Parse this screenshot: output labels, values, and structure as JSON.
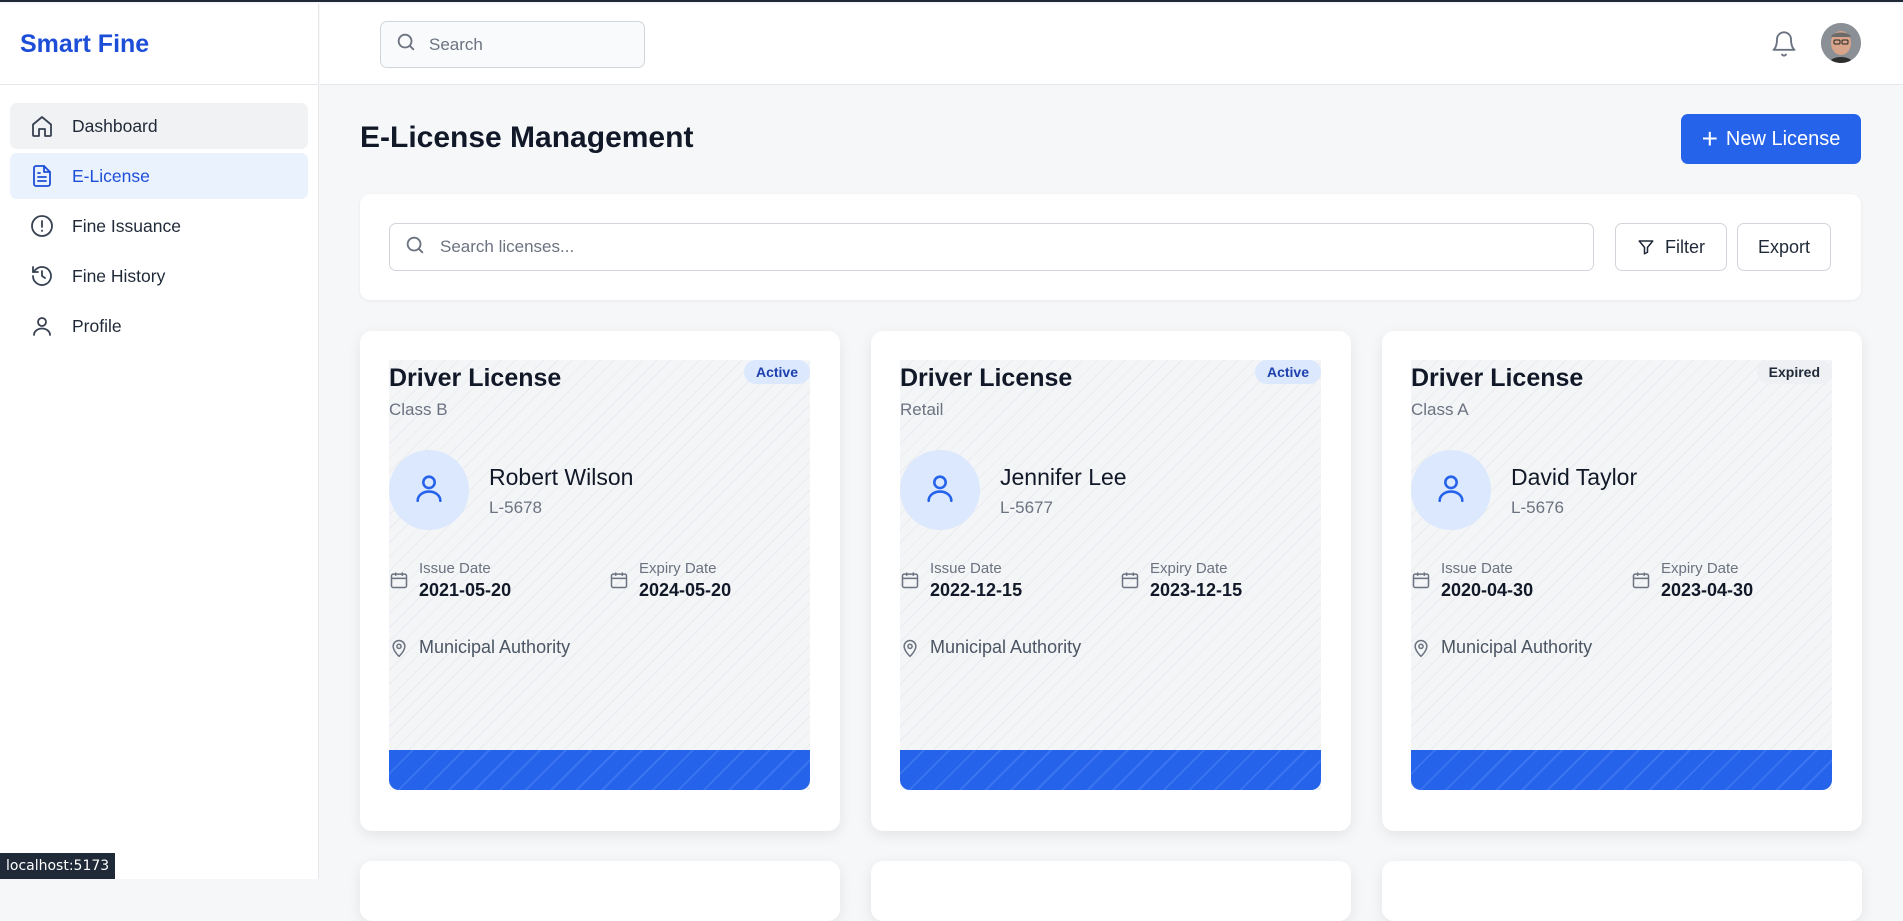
{
  "app": {
    "brand": "Smart Fine"
  },
  "sidebar": {
    "items": [
      {
        "label": "Dashboard",
        "icon": "home-icon"
      },
      {
        "label": "E-License",
        "icon": "document-icon"
      },
      {
        "label": "Fine Issuance",
        "icon": "alert-circle-icon"
      },
      {
        "label": "Fine History",
        "icon": "history-icon"
      },
      {
        "label": "Profile",
        "icon": "user-icon"
      }
    ],
    "active": "E-License"
  },
  "topbar": {
    "search_placeholder": "Search"
  },
  "page": {
    "title": "E-License Management",
    "new_button": "New License",
    "search_placeholder": "Search licenses...",
    "filter_label": "Filter",
    "export_label": "Export"
  },
  "licenses": [
    {
      "type": "Driver License",
      "class": "Class B",
      "status": "Active",
      "name": "Robert Wilson",
      "id": "L-5678",
      "issue_label": "Issue Date",
      "issue": "2021-05-20",
      "expiry_label": "Expiry Date",
      "expiry": "2024-05-20",
      "authority": "Municipal Authority"
    },
    {
      "type": "Driver License",
      "class": "Retail",
      "status": "Active",
      "name": "Jennifer Lee",
      "id": "L-5677",
      "issue_label": "Issue Date",
      "issue": "2022-12-15",
      "expiry_label": "Expiry Date",
      "expiry": "2023-12-15",
      "authority": "Municipal Authority"
    },
    {
      "type": "Driver License",
      "class": "Class A",
      "status": "Expired",
      "name": "David Taylor",
      "id": "L-5676",
      "issue_label": "Issue Date",
      "issue": "2020-04-30",
      "expiry_label": "Expiry Date",
      "expiry": "2023-04-30",
      "authority": "Municipal Authority"
    }
  ],
  "colors": {
    "accent": "#2563eb",
    "brand": "#1d4ed8",
    "active_bg": "#eaf2fe",
    "status_active_bg": "#dbe8fd"
  },
  "statusbar": {
    "url": "localhost:5173"
  }
}
